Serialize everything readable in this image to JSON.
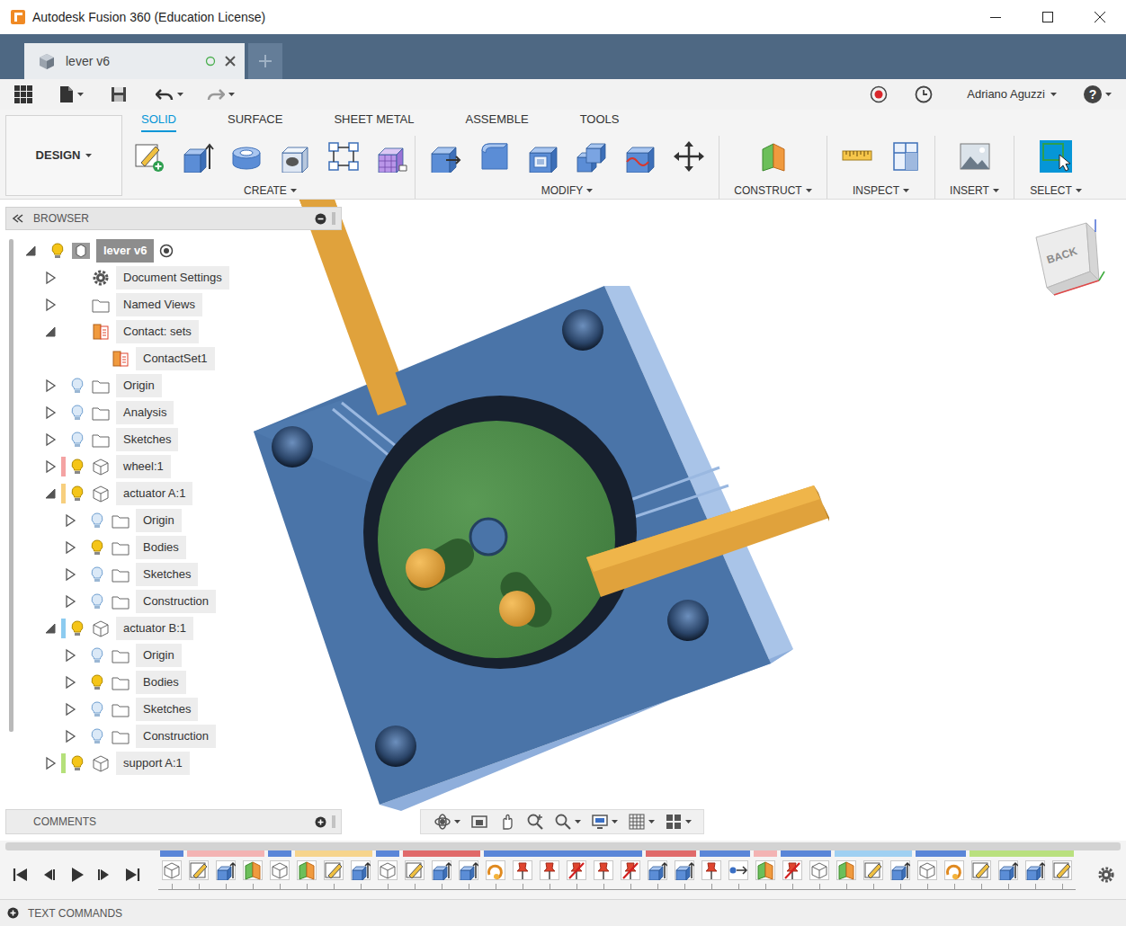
{
  "window": {
    "title": "Autodesk Fusion 360 (Education License)"
  },
  "document_tab": {
    "label": "lever v6"
  },
  "toolbar": {
    "user": "Adriano Aguzzi",
    "help": "?"
  },
  "workspace": {
    "label": "DESIGN"
  },
  "ribbon_tabs": [
    {
      "label": "SOLID",
      "selected": true
    },
    {
      "label": "SURFACE",
      "selected": false
    },
    {
      "label": "SHEET METAL",
      "selected": false
    },
    {
      "label": "ASSEMBLE",
      "selected": false
    },
    {
      "label": "TOOLS",
      "selected": false
    }
  ],
  "ribbon_groups": [
    {
      "label": "CREATE",
      "active": false
    },
    {
      "label": "MODIFY",
      "active": false
    },
    {
      "label": "CONSTRUCT",
      "active": false
    },
    {
      "label": "INSPECT",
      "active": false
    },
    {
      "label": "INSERT",
      "active": false
    },
    {
      "label": "SELECT",
      "active": true
    }
  ],
  "browser": {
    "title": "BROWSER",
    "items": [
      {
        "label": "lever v6",
        "level": 0,
        "kind": "document",
        "expanded": true,
        "visible": true,
        "selected": true
      },
      {
        "label": "Document Settings",
        "level": 1,
        "kind": "settings",
        "expanded": false,
        "visible": null,
        "selected": false
      },
      {
        "label": "Named Views",
        "level": 1,
        "kind": "folder",
        "expanded": false,
        "visible": null,
        "selected": false
      },
      {
        "label": "Contact: sets",
        "level": 1,
        "kind": "contact",
        "expanded": true,
        "visible": null,
        "selected": false
      },
      {
        "label": "ContactSet1",
        "level": 2,
        "kind": "contact",
        "expanded": null,
        "visible": null,
        "selected": false
      },
      {
        "label": "Origin",
        "level": 1,
        "kind": "folder",
        "expanded": false,
        "visible": false,
        "selected": false
      },
      {
        "label": "Analysis",
        "level": 1,
        "kind": "folder",
        "expanded": false,
        "visible": false,
        "selected": false
      },
      {
        "label": "Sketches",
        "level": 1,
        "kind": "folder",
        "expanded": false,
        "visible": false,
        "selected": false
      },
      {
        "label": "wheel:1",
        "level": 1,
        "kind": "component",
        "color": "#f4a3a3",
        "expanded": false,
        "visible": true,
        "selected": false
      },
      {
        "label": "actuator A:1",
        "level": 1,
        "kind": "component",
        "color": "#f7cf7e",
        "expanded": true,
        "visible": true,
        "selected": false
      },
      {
        "label": "Origin",
        "level": 2,
        "kind": "folder",
        "expanded": false,
        "visible": false,
        "selected": false
      },
      {
        "label": "Bodies",
        "level": 2,
        "kind": "folder",
        "expanded": false,
        "visible": true,
        "selected": false
      },
      {
        "label": "Sketches",
        "level": 2,
        "kind": "folder",
        "expanded": false,
        "visible": false,
        "selected": false
      },
      {
        "label": "Construction",
        "level": 2,
        "kind": "folder",
        "expanded": false,
        "visible": false,
        "selected": false
      },
      {
        "label": "actuator B:1",
        "level": 1,
        "kind": "component",
        "color": "#8ccbf0",
        "expanded": true,
        "visible": true,
        "selected": false
      },
      {
        "label": "Origin",
        "level": 2,
        "kind": "folder",
        "expanded": false,
        "visible": false,
        "selected": false
      },
      {
        "label": "Bodies",
        "level": 2,
        "kind": "folder",
        "expanded": false,
        "visible": true,
        "selected": false
      },
      {
        "label": "Sketches",
        "level": 2,
        "kind": "folder",
        "expanded": false,
        "visible": false,
        "selected": false
      },
      {
        "label": "Construction",
        "level": 2,
        "kind": "folder",
        "expanded": false,
        "visible": false,
        "selected": false
      },
      {
        "label": "support A:1",
        "level": 1,
        "kind": "component",
        "color": "#b5e07a",
        "expanded": false,
        "visible": true,
        "selected": false
      }
    ]
  },
  "viewcube": {
    "face": "BACK"
  },
  "comments": {
    "title": "COMMENTS"
  },
  "timeline": {
    "features": [
      {
        "kind": "component",
        "suppressed": false,
        "color": "#5a86d8"
      },
      {
        "kind": "sketch",
        "suppressed": false,
        "color": "#f3b3b3"
      },
      {
        "kind": "extrude",
        "suppressed": false,
        "color": "#f3b3b3"
      },
      {
        "kind": "plane",
        "suppressed": false,
        "color": "#f3b3b3"
      },
      {
        "kind": "component",
        "suppressed": false,
        "color": "#5a86d8"
      },
      {
        "kind": "plane",
        "suppressed": false,
        "color": "#f6d48c"
      },
      {
        "kind": "sketch",
        "suppressed": false,
        "color": "#f6d48c"
      },
      {
        "kind": "extrude",
        "suppressed": false,
        "color": "#f6d48c"
      },
      {
        "kind": "component",
        "suppressed": false,
        "color": "#5a86d8"
      },
      {
        "kind": "sketch",
        "suppressed": false,
        "color": "#e06a6a"
      },
      {
        "kind": "extrude",
        "suppressed": false,
        "color": "#e06a6a"
      },
      {
        "kind": "extrude",
        "suppressed": false,
        "color": "#e06a6a"
      },
      {
        "kind": "revolve",
        "suppressed": false,
        "color": "#5a86d8"
      },
      {
        "kind": "joint",
        "suppressed": false,
        "color": "#5a86d8"
      },
      {
        "kind": "joint",
        "suppressed": false,
        "color": "#5a86d8"
      },
      {
        "kind": "joint",
        "suppressed": true,
        "color": "#5a86d8"
      },
      {
        "kind": "joint",
        "suppressed": false,
        "color": "#5a86d8"
      },
      {
        "kind": "joint",
        "suppressed": true,
        "color": "#5a86d8"
      },
      {
        "kind": "extrude",
        "suppressed": false,
        "color": "#e06a6a"
      },
      {
        "kind": "extrude",
        "suppressed": false,
        "color": "#e06a6a"
      },
      {
        "kind": "joint",
        "suppressed": false,
        "color": "#5a86d8"
      },
      {
        "kind": "motion",
        "suppressed": false,
        "color": "#5a86d8"
      },
      {
        "kind": "plane",
        "suppressed": false,
        "color": "#f3b3b3"
      },
      {
        "kind": "joint",
        "suppressed": true,
        "color": "#5a86d8"
      },
      {
        "kind": "component",
        "suppressed": false,
        "color": "#5a86d8"
      },
      {
        "kind": "plane",
        "suppressed": false,
        "color": "#9fd0f2"
      },
      {
        "kind": "sketch",
        "suppressed": false,
        "color": "#9fd0f2"
      },
      {
        "kind": "extrude",
        "suppressed": false,
        "color": "#9fd0f2"
      },
      {
        "kind": "component",
        "suppressed": false,
        "color": "#5a86d8"
      },
      {
        "kind": "revolve",
        "suppressed": false,
        "color": "#5a86d8"
      },
      {
        "kind": "sketch",
        "suppressed": false,
        "color": "#b9e07e"
      },
      {
        "kind": "extrude",
        "suppressed": false,
        "color": "#b9e07e"
      },
      {
        "kind": "extrude",
        "suppressed": false,
        "color": "#b9e07e"
      },
      {
        "kind": "sketch",
        "suppressed": false,
        "color": "#b9e07e"
      }
    ]
  },
  "text_commands": {
    "title": "TEXT COMMANDS"
  }
}
